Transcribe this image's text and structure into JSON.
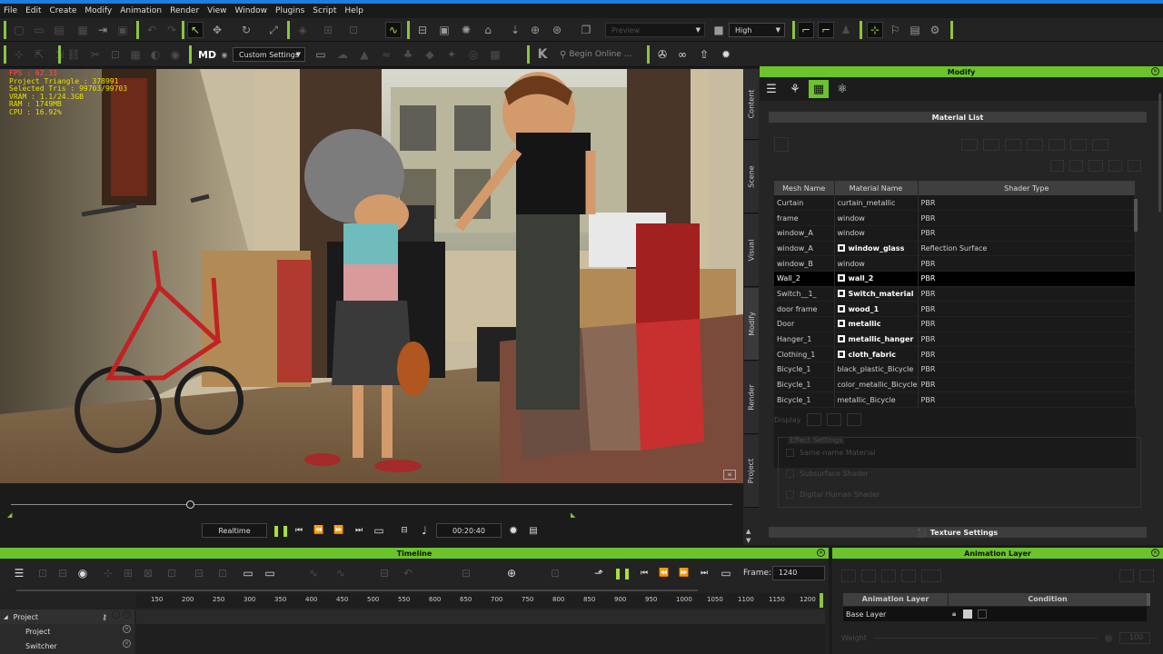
{
  "menu": [
    "File",
    "Edit",
    "Create",
    "Modify",
    "Animation",
    "Render",
    "View",
    "Window",
    "Plugins",
    "Script",
    "Help"
  ],
  "toolbar1": {
    "preview_label": "Preview",
    "quality_value": "High"
  },
  "toolbar2": {
    "md_label": "MD",
    "custom_settings": "Custom Settings",
    "search_placeholder": "Begin Online ..."
  },
  "stats": {
    "fps": "FPS : 62.33",
    "project_triangle": "Project Triangle : 378991",
    "selected_tris": "Selected Tris : 99703/99703",
    "vram": "VRAM : 1.1/24.3GB",
    "ram": "RAM : 1749MB",
    "cpu": "CPU : 16.92%"
  },
  "playback": {
    "mode": "Realtime",
    "time": "00:20:40"
  },
  "side_tabs": [
    "Content",
    "Scene",
    "Visual",
    "Modify",
    "Render",
    "Project"
  ],
  "modify": {
    "title": "Modify",
    "material_list_title": "Material List",
    "columns": [
      "Mesh Name",
      "Material Name",
      "Shader Type"
    ],
    "rows": [
      {
        "mesh": "Curtain",
        "material": "curtain_metallic",
        "shader": "PBR",
        "bold": false
      },
      {
        "mesh": "frame",
        "material": "window",
        "shader": "PBR",
        "bold": false
      },
      {
        "mesh": "window_A",
        "material": "window",
        "shader": "PBR",
        "bold": false
      },
      {
        "mesh": "window_A",
        "material": "window_glass",
        "shader": "Reflection Surface",
        "bold": true
      },
      {
        "mesh": "window_B",
        "material": "window",
        "shader": "PBR",
        "bold": false
      },
      {
        "mesh": "Wall_2",
        "material": "wall_2",
        "shader": "PBR",
        "bold": true,
        "selected": true
      },
      {
        "mesh": "Switch__1_",
        "material": "Switch_material",
        "shader": "PBR",
        "bold": true
      },
      {
        "mesh": "door frame",
        "material": "wood_1",
        "shader": "PBR",
        "bold": true
      },
      {
        "mesh": "Door",
        "material": "metallic",
        "shader": "PBR",
        "bold": true
      },
      {
        "mesh": "Hanger_1",
        "material": "metallic_hanger",
        "shader": "PBR",
        "bold": true
      },
      {
        "mesh": "Clothing_1",
        "material": "cloth_fabric",
        "shader": "PBR",
        "bold": true
      },
      {
        "mesh": "Bicycle_1",
        "material": "black_plastic_Bicycle",
        "shader": "PBR",
        "bold": false
      },
      {
        "mesh": "Bicycle_1",
        "material": "color_metallic_Bicycle",
        "shader": "PBR",
        "bold": false
      },
      {
        "mesh": "Bicycle_1",
        "material": "metallic_Bicycle",
        "shader": "PBR",
        "bold": false
      }
    ],
    "display_label": "Display",
    "effect_settings": "Effect Settings",
    "options": [
      "Same-name Material",
      "Subsurface Shader",
      "Digital Human Shader"
    ],
    "texture_settings": "Texture Settings"
  },
  "timeline": {
    "title": "Timeline",
    "frame_label": "Frame:",
    "frame_value": "1240",
    "ruler": [
      "150",
      "200",
      "250",
      "300",
      "350",
      "400",
      "450",
      "500",
      "550",
      "600",
      "650",
      "700",
      "750",
      "800",
      "850",
      "900",
      "950",
      "1000",
      "1050",
      "1100",
      "1150",
      "1200"
    ],
    "tracks": [
      "Project",
      "Project",
      "Switcher"
    ]
  },
  "anim_layer": {
    "title": "Animation Layer",
    "columns": [
      "Animation Layer",
      "Condition"
    ],
    "base_layer": "Base Layer",
    "weight_label": "Weight",
    "weight_value": "100"
  },
  "colors": {
    "accent": "#6ac42a",
    "stats": "#e8e000",
    "fps": "#ff5050"
  }
}
